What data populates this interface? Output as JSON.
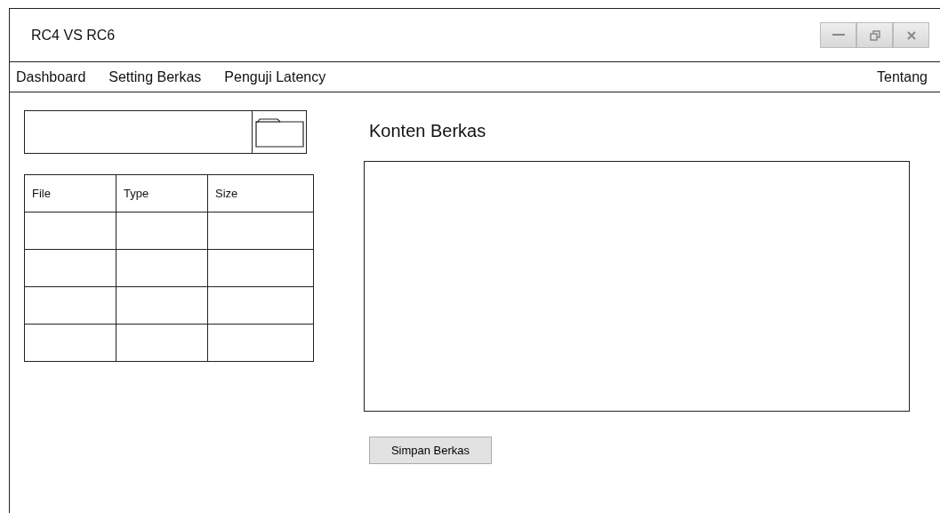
{
  "window": {
    "title": "RC4 VS RC6"
  },
  "menu": {
    "items": [
      {
        "label": "Dashboard"
      },
      {
        "label": "Setting Berkas"
      },
      {
        "label": "Penguji Latency"
      }
    ],
    "right_item": {
      "label": "Tentang"
    }
  },
  "file_table": {
    "columns": [
      "File",
      "Type",
      "Size"
    ],
    "rows": [
      {},
      {},
      {},
      {}
    ]
  },
  "content": {
    "heading": "Konten Berkas",
    "save_button": "Simpan Berkas"
  }
}
